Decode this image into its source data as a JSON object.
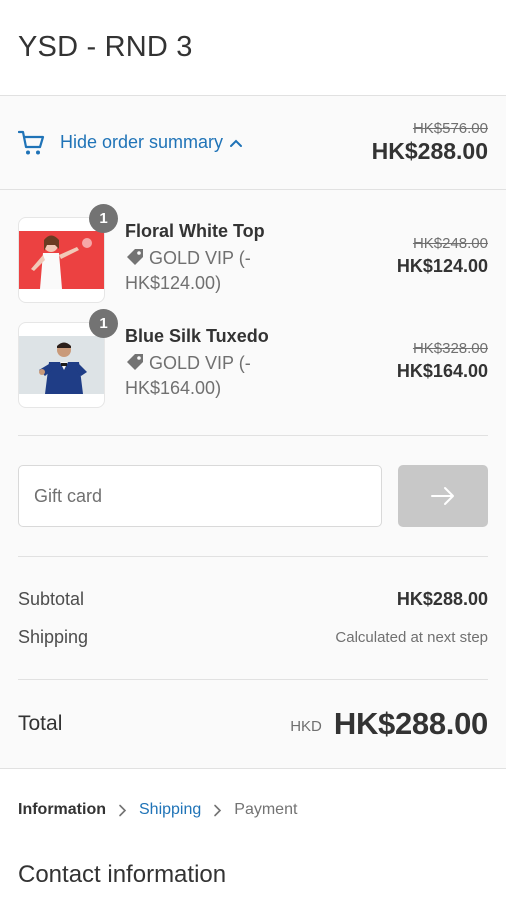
{
  "header": {
    "title": "YSD - RND 3"
  },
  "summary": {
    "toggle_label": "Hide order summary",
    "original_total": "HK$576.00",
    "total": "HK$288.00"
  },
  "products": [
    {
      "name": "Floral White Top",
      "quantity": "1",
      "discount": "GOLD VIP (-HK$124.00)",
      "original_price": "HK$248.00",
      "price": "HK$124.00"
    },
    {
      "name": "Blue Silk Tuxedo",
      "quantity": "1",
      "discount": "GOLD VIP (-HK$164.00)",
      "original_price": "HK$328.00",
      "price": "HK$164.00"
    }
  ],
  "gift_card": {
    "placeholder": "Gift card"
  },
  "lines": {
    "subtotal_label": "Subtotal",
    "subtotal_value": "HK$288.00",
    "shipping_label": "Shipping",
    "shipping_value": "Calculated at next step"
  },
  "total": {
    "label": "Total",
    "currency": "HKD",
    "value": "HK$288.00"
  },
  "breadcrumb": {
    "information": "Information",
    "shipping": "Shipping",
    "payment": "Payment"
  },
  "contact": {
    "title": "Contact information"
  },
  "colors": {
    "accent": "#1f73b7",
    "badge": "#737373",
    "button_disabled": "#c8c8c8"
  }
}
